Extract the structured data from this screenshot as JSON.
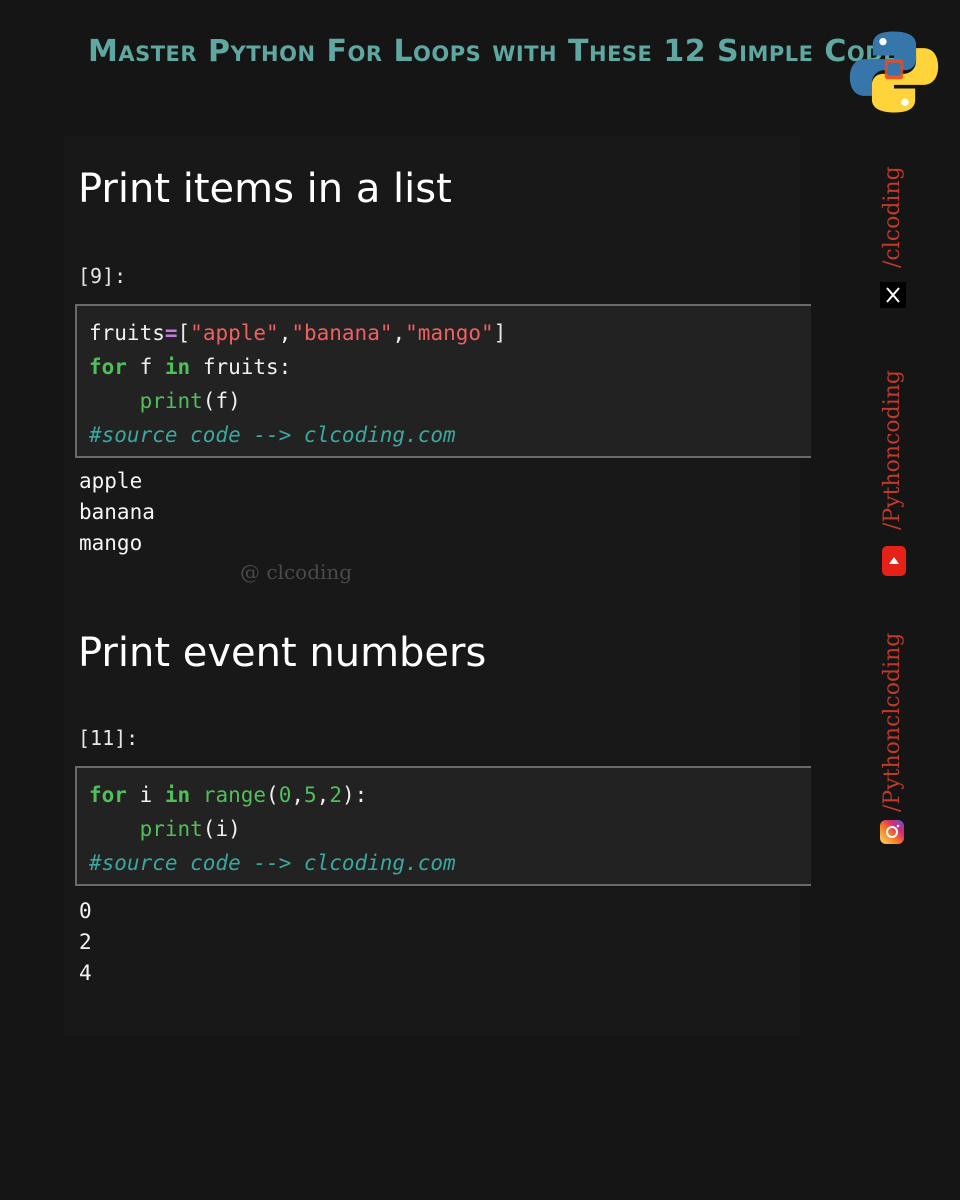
{
  "header": {
    "title": "Master Python For Loops with These 12 Simple Codes",
    "logo_icon": "python-logo-icon"
  },
  "sections": [
    {
      "title": "Print items in a list",
      "prompt": "[9]:",
      "code_lines": [
        "fruits=[\"apple\",\"banana\",\"mango\"]",
        "for f in fruits:",
        "    print(f)",
        "#source code --> clcoding.com"
      ],
      "output": [
        "apple",
        "banana",
        "mango"
      ]
    },
    {
      "title": "Print event numbers",
      "prompt": "[11]:",
      "code_lines": [
        "for i in range(0,5,2):",
        "    print(i)",
        "#source code --> clcoding.com"
      ],
      "output": [
        "0",
        "2",
        "4"
      ]
    }
  ],
  "watermark": "@ clcoding",
  "social": [
    {
      "handle": "/clcoding",
      "icon": "x-twitter-icon"
    },
    {
      "handle": "/Pythoncoding",
      "icon": "youtube-icon"
    },
    {
      "handle": "/Pythonclcoding",
      "icon": "instagram-icon"
    }
  ],
  "colors": {
    "background": "#151515",
    "title": "#5fa8a2",
    "keyword": "#4fbf5a",
    "string": "#f06060",
    "comment": "#3aa8a0",
    "social_text": "#c0392b"
  }
}
